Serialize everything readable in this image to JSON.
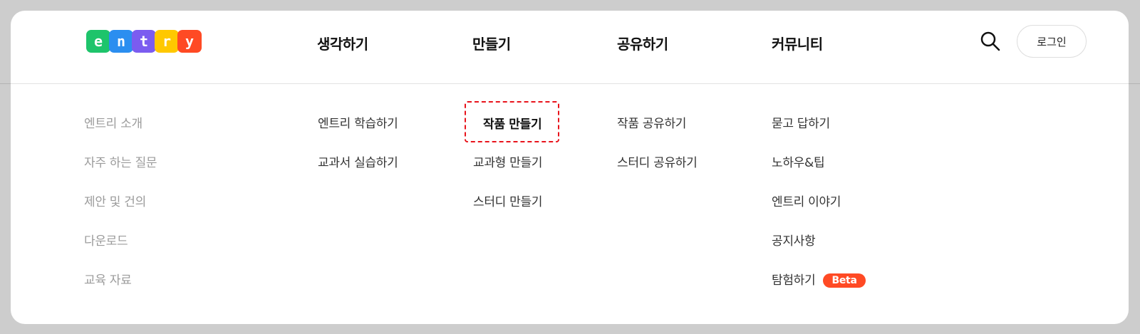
{
  "logo": {
    "letters": [
      "e",
      "n",
      "t",
      "r",
      "y"
    ],
    "colors": [
      "#1ec46b",
      "#2b8ef0",
      "#7b5cf0",
      "#ffc800",
      "#ff4a24"
    ]
  },
  "nav": {
    "items": [
      "생각하기",
      "만들기",
      "공유하기",
      "커뮤니티"
    ],
    "search_icon": "search-icon",
    "login_label": "로그인"
  },
  "submenu": {
    "about": [
      "엔트리 소개",
      "자주 하는 질문",
      "제안 및 건의",
      "다운로드",
      "교육 자료"
    ],
    "think": [
      "엔트리 학습하기",
      "교과서 실습하기"
    ],
    "make": [
      "작품 만들기",
      "교과형 만들기",
      "스터디 만들기"
    ],
    "share": [
      "작품 공유하기",
      "스터디 공유하기"
    ],
    "community": [
      "묻고 답하기",
      "노하우&팁",
      "엔트리 이야기",
      "공지사항",
      "탐험하기"
    ],
    "beta_label": "Beta"
  },
  "colors": {
    "accent_red": "#e8131b",
    "beta": "#ff4a24"
  }
}
